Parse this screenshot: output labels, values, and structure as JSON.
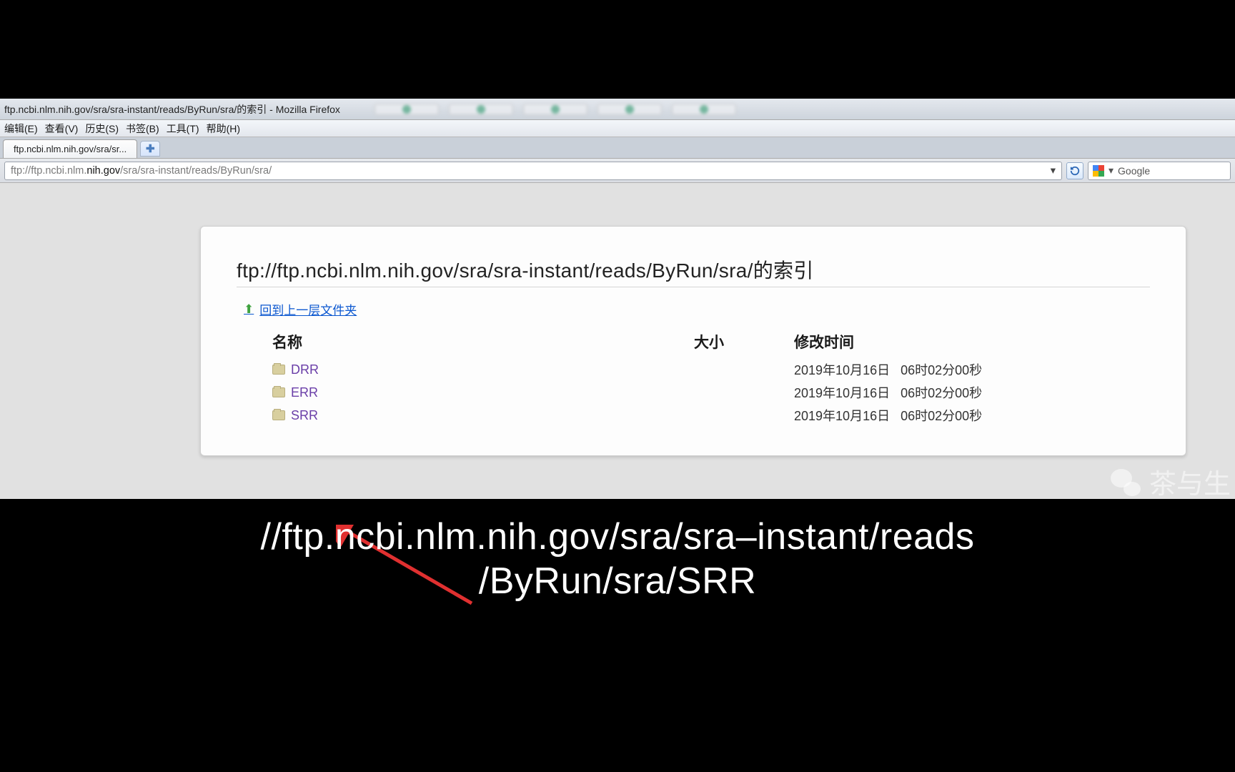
{
  "window_title": "ftp.ncbi.nlm.nih.gov/sra/sra-instant/reads/ByRun/sra/的索引 - Mozilla Firefox",
  "menu": {
    "edit": "编辑(E)",
    "view": "查看(V)",
    "history": "历史(S)",
    "bookmarks": "书签(B)",
    "tools": "工具(T)",
    "help": "帮助(H)"
  },
  "tab_label": "ftp.ncbi.nlm.nih.gov/sra/sr...",
  "url": {
    "prefix": "ftp://ftp.ncbi.nlm.",
    "host": "nih.gov",
    "suffix": "/sra/sra-instant/reads/ByRun/sra/"
  },
  "dropdown_marker": "▾",
  "search_placeholder": "Google",
  "page": {
    "heading_prefix": "ftp://ftp.ncbi.nlm.nih.gov/sra/sra-instant/reads/ByRun/sra/",
    "heading_suffix": "的索引",
    "up_link": "回到上一层文件夹",
    "cols": {
      "name": "名称",
      "size": "大小",
      "mtime": "修改时间"
    },
    "rows": [
      {
        "name": "DRR",
        "size": "",
        "date": "2019年10月16日",
        "time": "06时02分00秒"
      },
      {
        "name": "ERR",
        "size": "",
        "date": "2019年10月16日",
        "time": "06时02分00秒"
      },
      {
        "name": "SRR",
        "size": "",
        "date": "2019年10月16日",
        "time": "06时02分00秒"
      }
    ]
  },
  "caption_line1": "//ftp.ncbi.nlm.nih.gov/sra/sra–instant/reads",
  "caption_line2": "/ByRun/sra/SRR",
  "watermark_text": "茶与生"
}
